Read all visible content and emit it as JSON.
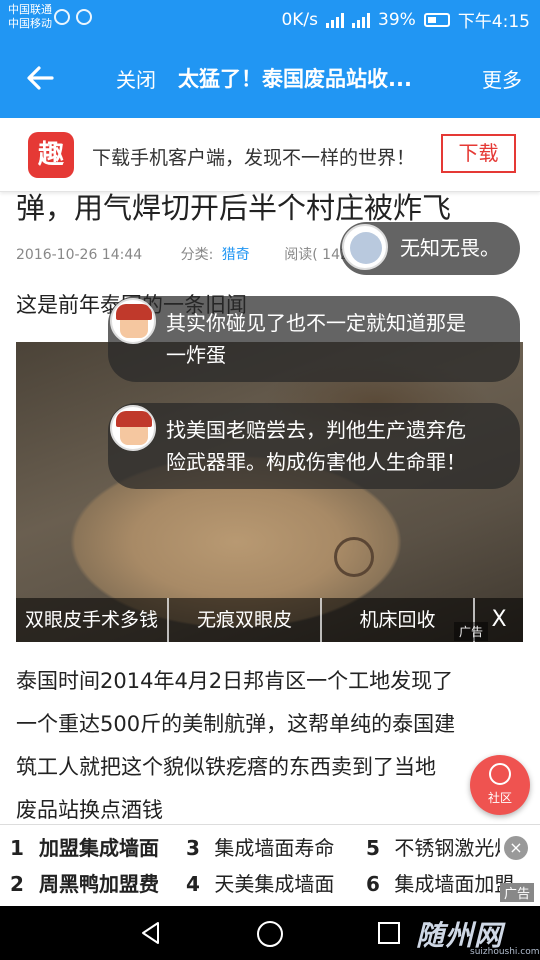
{
  "status_bar": {
    "carrier1": "中国联通",
    "carrier2": "中国移动",
    "speed": "0K/s",
    "network": "4G",
    "battery": "39%",
    "time": "下午4:15"
  },
  "app_bar": {
    "close_label": "关闭",
    "title": "太猛了！泰国废品站收...",
    "more_label": "更多"
  },
  "download_banner": {
    "logo_char": "趣",
    "text": "下载手机客户端，发现不一样的世界！",
    "button_label": "下载"
  },
  "article": {
    "title_partial": "弹，用气焊切开后半个村庄被炸飞",
    "date": "2016-10-26 14:44",
    "category_label": "分类:",
    "category": "猎奇",
    "reads_label": "阅读( 142 )",
    "para1": "这是前年泰国的一条旧闻",
    "body_lines": [
      "泰国时间2014年4月2日邦肯区一个工地发现了",
      "一个重达500斤的美制航弹，这帮单纯的泰国建",
      "筑工人就把这个貌似铁疙瘩的东西卖到了当地",
      "废品站换点酒钱"
    ]
  },
  "image_ad": {
    "items": [
      "双眼皮手术多钱",
      "无痕双眼皮",
      "机床回收"
    ],
    "close": "X",
    "tag": "广告"
  },
  "danmaku": {
    "b1": "无知无畏。",
    "b2_line1": "其实你碰见了也不一定就知道那是",
    "b2_line2": "一炸蛋",
    "b3_line1": "找美国老赔尝去，判他生产遗弃危",
    "b3_line2": "险武器罪。构成伤害他人生命罪！"
  },
  "fab": {
    "label": "社区"
  },
  "bottom_ad": {
    "keywords": [
      {
        "num": "1",
        "text": "加盟集成墙面"
      },
      {
        "num": "3",
        "text": "集成墙面寿命"
      },
      {
        "num": "5",
        "text": "不锈钢激光焊"
      },
      {
        "num": "2",
        "text": "周黑鸭加盟费"
      },
      {
        "num": "4",
        "text": "天美集成墙面"
      },
      {
        "num": "6",
        "text": "集成墙面加盟"
      }
    ],
    "close": "×",
    "tag": "广告"
  },
  "watermark": {
    "main": "随州网",
    "sub": "suizhoushi.com"
  },
  "colors": {
    "primary": "#2196f3",
    "accent": "#e53935",
    "fab": "#ef5350"
  }
}
